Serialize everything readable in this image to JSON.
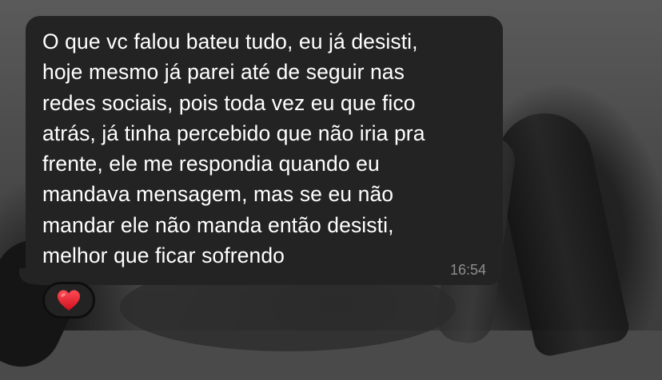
{
  "message": {
    "lines": [
      "O que vc falou bateu tudo, eu já desisti,",
      "hoje mesmo já parei até de seguir nas",
      "redes sociais, pois toda vez eu que fico",
      "atrás, já tinha percebido que não iria pra",
      "frente, ele me respondia quando eu",
      "mandava mensagem, mas se eu não",
      "mandar ele não manda então desisti,",
      "melhor que ficar sofrendo"
    ],
    "timestamp": "16:54",
    "bubble_color": "#232323",
    "text_color": "#ffffff",
    "timestamp_color": "#8e8e8e"
  },
  "reaction": {
    "icon": "red-heart-icon",
    "color": "#e3202d"
  }
}
